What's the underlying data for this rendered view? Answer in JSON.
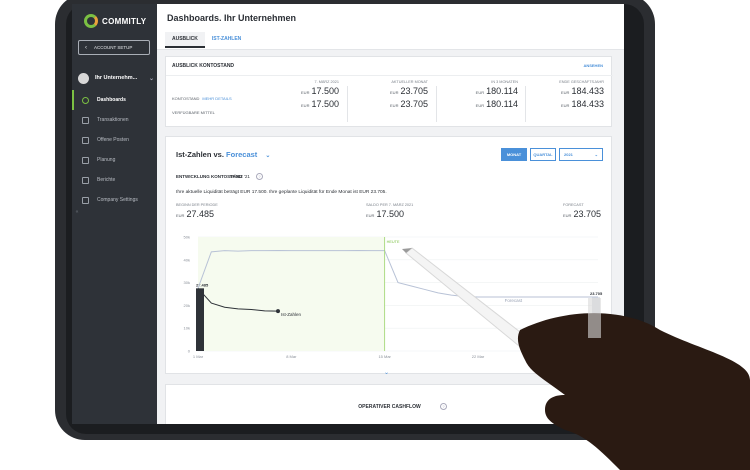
{
  "brand": {
    "name": "COMMITLY"
  },
  "sidebar": {
    "account_setup": "ACCOUNT SETUP",
    "company": "Ihr Unternehm...",
    "items": [
      {
        "label": "Dashboards",
        "icon": "dashboard-icon",
        "active": true
      },
      {
        "label": "Transaktionen",
        "icon": "transactions-icon"
      },
      {
        "label": "Offene Posten",
        "icon": "open-items-icon"
      },
      {
        "label": "Planung",
        "icon": "planning-icon"
      },
      {
        "label": "Berichte",
        "icon": "reports-icon"
      },
      {
        "label": "Company Settings",
        "icon": "settings-icon"
      }
    ]
  },
  "header": {
    "title": "Dashboards. Ihr Unternehmen",
    "tabs": [
      "AUSBLICK",
      "IST-ZAHLEN"
    ]
  },
  "kontostand": {
    "title": "AUSBLICK KONTOSTAND",
    "link": "ANSEHEN",
    "row1_label": "KONTOSTAND",
    "row1_more": "MEHR DETAILS",
    "row2_label": "VERFÜGBARE MITTEL",
    "currency": "EUR",
    "columns": [
      {
        "header": "7. MÄRZ 2021",
        "v1": "17.500",
        "v2": "17.500"
      },
      {
        "header": "AKTUELLER MONAT",
        "v1": "23.705",
        "v2": "23.705"
      },
      {
        "header": "IN 3 MONATEN",
        "v1": "180.114",
        "v2": "180.114"
      },
      {
        "header": "ENDE GESCHÄFTSJAHR",
        "v1": "184.433",
        "v2": "184.433"
      }
    ]
  },
  "entwicklung": {
    "title_left": "Ist-Zahlen vs.",
    "title_right": "Forecast",
    "buttons": {
      "monat": "MONAT",
      "quartal": "QUARTAL",
      "select": "2021"
    },
    "label": "ENTWICKLUNG KONTOSTAND",
    "month": "MÄRZ '21",
    "summary": "Ihre aktuelle Liquidität beträgt EUR 17.500. Ihre geplante Liquidität für Ende Monat ist EUR 23.705.",
    "currency": "EUR",
    "stats": [
      {
        "header": "BEGINN DER PERIODE",
        "value": "27.485"
      },
      {
        "header": "SALDO PER 7. MÄRZ 2021",
        "value": "17.500"
      },
      {
        "header": "FORECAST",
        "value": "23.705"
      }
    ]
  },
  "chart_data": {
    "type": "line",
    "y_ticks": [
      "50k",
      "40k",
      "30k",
      "20k",
      "10k",
      "0"
    ],
    "x_ticks": [
      "1 Mar",
      "8 Mar",
      "15 Mar",
      "22 Mar",
      "29 Mar"
    ],
    "ylim": [
      0,
      50000
    ],
    "today_label": "HEUTE",
    "colors": {
      "ist": "#2e3238",
      "forecast": "#b8c2d6",
      "today": "#9bd36b",
      "start_bar": "#2e3238",
      "end_bar": "#dfe2e7"
    },
    "series": [
      {
        "name": "Ist-Zahlen",
        "points": [
          [
            1,
            27485
          ],
          [
            2,
            21000
          ],
          [
            3,
            19200
          ],
          [
            4,
            18500
          ],
          [
            5,
            18200
          ],
          [
            6,
            17600
          ],
          [
            7,
            17500
          ]
        ]
      },
      {
        "name": "Forecast",
        "points": [
          [
            1,
            27485
          ],
          [
            2,
            43500
          ],
          [
            3,
            44000
          ],
          [
            4,
            43800
          ],
          [
            5,
            44000
          ],
          [
            6,
            44000
          ],
          [
            7,
            44100
          ],
          [
            8,
            44000
          ],
          [
            9,
            44000
          ],
          [
            10,
            44000
          ],
          [
            11,
            44000
          ],
          [
            12,
            44000
          ],
          [
            13,
            44100
          ],
          [
            14,
            44000
          ],
          [
            15,
            44000
          ],
          [
            16,
            30000
          ],
          [
            17,
            28500
          ],
          [
            18,
            27000
          ],
          [
            19,
            25500
          ],
          [
            20,
            24500
          ],
          [
            21,
            23900
          ],
          [
            22,
            23705
          ],
          [
            23,
            23705
          ],
          [
            24,
            23705
          ],
          [
            25,
            23705
          ],
          [
            26,
            23705
          ],
          [
            27,
            23705
          ],
          [
            28,
            23705
          ],
          [
            29,
            23705
          ],
          [
            30,
            23705
          ],
          [
            31,
            23705
          ]
        ]
      }
    ],
    "start_value_label": "27.485",
    "end_value_label": "23.705",
    "ist_label": "Ist-Zahlen",
    "forecast_label": "Forecast"
  },
  "cashflow": {
    "title": "OPERATIVER CASHFLOW"
  }
}
